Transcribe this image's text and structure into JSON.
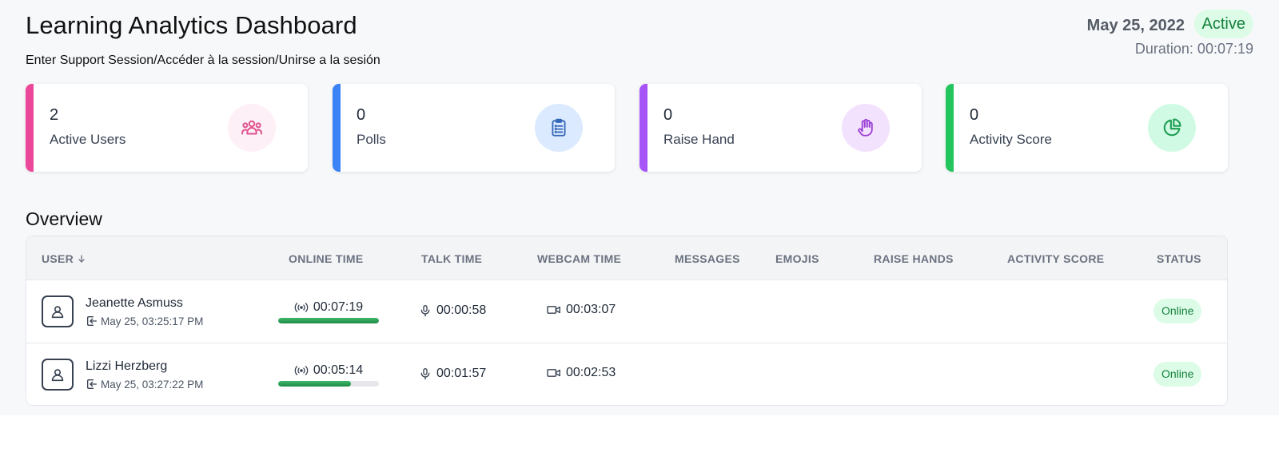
{
  "header": {
    "title": "Learning Analytics Dashboard",
    "subtitle": "Enter Support Session/Accéder à la session/Unirse a la sesión",
    "date": "May 25, 2022",
    "status": "Active",
    "duration": "Duration: 00:07:19"
  },
  "cards": [
    {
      "value": "2",
      "label": "Active Users",
      "icon": "users-icon",
      "color": "#ec4899",
      "icon_bg": "#fdf0f6"
    },
    {
      "value": "0",
      "label": "Polls",
      "icon": "clipboard-list-icon",
      "color": "#3b82f6",
      "icon_bg": "#dbeafe"
    },
    {
      "value": "0",
      "label": "Raise Hand",
      "icon": "hand-icon",
      "color": "#a855f7",
      "icon_bg": "#f3e2fd"
    },
    {
      "value": "0",
      "label": "Activity Score",
      "icon": "pie-chart-icon",
      "color": "#22c55e",
      "icon_bg": "#d1fae5"
    }
  ],
  "overview": {
    "heading": "Overview",
    "columns": [
      "USER",
      "ONLINE TIME",
      "TALK TIME",
      "WEBCAM TIME",
      "MESSAGES",
      "EMOJIS",
      "RAISE HANDS",
      "ACTIVITY SCORE",
      "STATUS"
    ],
    "rows": [
      {
        "name": "Jeanette Asmuss",
        "login": "May 25, 03:25:17 PM",
        "online_time": "00:07:19",
        "online_fraction": 1.0,
        "talk_time": "00:00:58",
        "webcam_time": "00:03:07",
        "status": "Online"
      },
      {
        "name": "Lizzi Herzberg",
        "login": "May 25, 03:27:22 PM",
        "online_time": "00:05:14",
        "online_fraction": 0.72,
        "talk_time": "00:01:57",
        "webcam_time": "00:02:53",
        "status": "Online"
      }
    ]
  },
  "colors": {
    "accent_green": "#15803d",
    "badge_green_bg": "#dcfce7"
  }
}
